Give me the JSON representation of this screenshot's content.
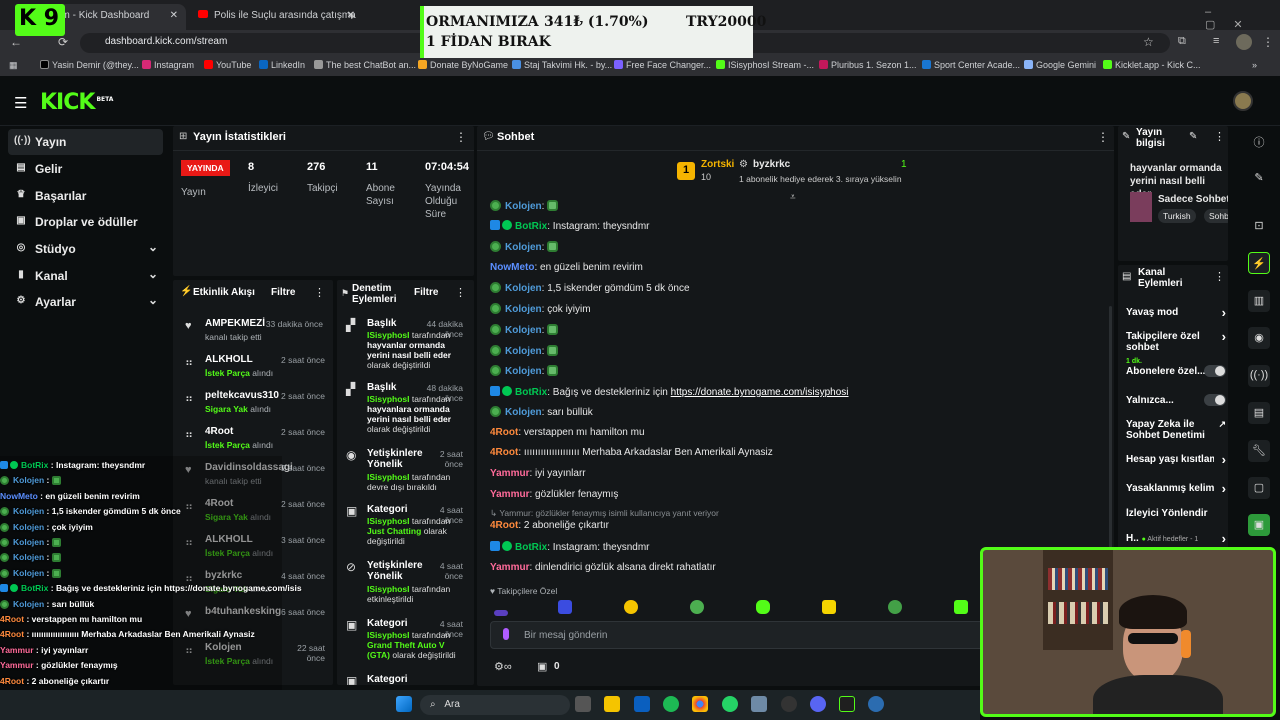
{
  "browser": {
    "tabs": [
      {
        "label": "am - Kick Dashboard"
      },
      {
        "label": "Polis ile Suçlu arasında çatışma"
      }
    ],
    "url": "dashboard.kick.com/stream",
    "bookmarks": [
      "Yasin Demir (@they...",
      "Instagram",
      "YouTube",
      "LinkedIn",
      "The best ChatBot an...",
      "Donate ByNoGame",
      "Staj Takvimi Hk. - by...",
      "Free Face Changer...",
      "ISisyphosI Stream -...",
      "Pluribus 1. Sezon 1...",
      "Sport Center Acade...",
      "Google Gemini",
      "Kicklet.app - Kick C..."
    ]
  },
  "overlay": {
    "channel_badge": "9",
    "banner_line1": "ORMANIMIZA",
    "banner_amount": "341₺ (1.70%)",
    "banner_goal": "TRY20000",
    "banner_line2": "1 FİDAN BIRAK"
  },
  "brand": {
    "logo": "KICK",
    "beta": "BETA"
  },
  "sidebar": {
    "items": [
      {
        "label": "Yayın",
        "icon": "broadcast-icon"
      },
      {
        "label": "Gelir",
        "icon": "wallet-icon"
      },
      {
        "label": "Başarılar",
        "icon": "trophy-icon"
      },
      {
        "label": "Droplar ve ödüller",
        "icon": "gift-icon"
      },
      {
        "label": "Stüdyo",
        "icon": "studio-icon"
      },
      {
        "label": "Kanal",
        "icon": "channel-icon"
      },
      {
        "label": "Ayarlar",
        "icon": "gear-icon"
      }
    ]
  },
  "stats": {
    "title": "Yayın İstatistikleri",
    "live": "YAYINDA",
    "live_label": "Yayın",
    "items": [
      {
        "value": "8",
        "label": "İzleyici"
      },
      {
        "value": "276",
        "label": "Takipçi"
      },
      {
        "value": "11",
        "label": "Abone Sayısı"
      },
      {
        "value": "07:04:54",
        "label": "Yayında Olduğu Süre"
      }
    ]
  },
  "activity": {
    "title": "Etkinlik Akışı",
    "filter": "Filtre",
    "events": [
      {
        "name": "AMPEKMEZİ",
        "time": "33 dakika önce",
        "sub": "kanalı takip etti",
        "green": ""
      },
      {
        "name": "ALKHOLL",
        "time": "2 saat önce",
        "sub": "alındı",
        "green": "İstek Parça"
      },
      {
        "name": "peltekcavus310",
        "time": "2 saat önce",
        "sub": "alındı",
        "green": "Sigara Yak"
      },
      {
        "name": "4Root",
        "time": "2 saat önce",
        "sub": "alındı",
        "green": "İstek Parça"
      },
      {
        "name": "Davidinsoldassagi",
        "time": "2 saat önce",
        "sub": "kanalı takip etti",
        "green": ""
      },
      {
        "name": "4Root",
        "time": "2 saat önce",
        "sub": "alındı",
        "green": "Sigara Yak"
      },
      {
        "name": "ALKHOLL",
        "time": "3 saat önce",
        "sub": "alındı",
        "green": "İstek Parça"
      },
      {
        "name": "byzkrkc",
        "time": "4 saat önce",
        "sub": "alındı",
        "green": "Sigara Yak"
      },
      {
        "name": "b4tuhankesking",
        "time": "6 saat önce",
        "sub": "",
        "green": ""
      },
      {
        "name": "Kolojen",
        "time": "22 saat önce",
        "sub": "alındı",
        "green": "İstek Parça"
      }
    ]
  },
  "moderation": {
    "title": "Denetim Eylemleri",
    "filter": "Filtre",
    "entries": [
      {
        "title": "Başlık",
        "time": "44 dakika önce",
        "user": "ISisyphosI",
        "body": "tarafından",
        "detail": "hayvanlar ormanda yerini nasıl belli eder",
        "tail": "olarak değiştirildi"
      },
      {
        "title": "Başlık",
        "time": "48 dakika önce",
        "user": "ISisyphosI",
        "body": "tarafından",
        "detail": "hayvanlara ormanda yerini nasıl belli eder",
        "tail": "olarak değiştirildi"
      },
      {
        "title": "Yetişkinlere Yönelik",
        "time": "2 saat önce",
        "user": "ISisyphosI",
        "body": "tarafından",
        "detail": "",
        "tail": "devre dışı bırakıldı"
      },
      {
        "title": "Kategori",
        "time": "4 saat önce",
        "user": "ISisyphosI",
        "body": "tarafından",
        "detail": "Just Chatting",
        "tail": "olarak değiştirildi"
      },
      {
        "title": "Yetişkinlere Yönelik",
        "time": "4 saat önce",
        "user": "ISisyphosI",
        "body": "tarafından",
        "detail": "",
        "tail": "etkinleştirildi"
      },
      {
        "title": "Kategori",
        "time": "4 saat önce",
        "user": "ISisyphosI",
        "body": "tarafından",
        "detail": "Grand Theft Auto V (GTA)",
        "tail": "olarak değiştirildi"
      },
      {
        "title": "Kategori",
        "time": "",
        "user": "",
        "body": "",
        "detail": "",
        "tail": ""
      }
    ]
  },
  "chat": {
    "title": "Sohbet",
    "pinned_user": "Zortski",
    "pinned_count": "10",
    "gifter": "byzkrkc",
    "gift_count": "1",
    "gift_text": "1 abonelik hediye ederek 3. sıraya yükselin",
    "messages": [
      {
        "user": "Kolojen",
        "text": "",
        "color": "#4f9bd9",
        "type": "frog"
      },
      {
        "user": "BotRix",
        "text": "Instagram: theysndmr",
        "color": "#00c853",
        "type": "bot"
      },
      {
        "user": "Kolojen",
        "text": "",
        "color": "#4f9bd9",
        "type": "frog"
      },
      {
        "user": "NowMeto",
        "text": "en güzeli benim revirim",
        "color": "#5b8fff",
        "type": "plain"
      },
      {
        "user": "Kolojen",
        "text": "1,5 iskender gömdüm 5 dk önce",
        "color": "#4f9bd9",
        "type": "frog"
      },
      {
        "user": "Kolojen",
        "text": "çok iyiyim",
        "color": "#4f9bd9",
        "type": "frog"
      },
      {
        "user": "Kolojen",
        "text": "",
        "color": "#4f9bd9",
        "type": "frog"
      },
      {
        "user": "Kolojen",
        "text": "",
        "color": "#4f9bd9",
        "type": "frog"
      },
      {
        "user": "Kolojen",
        "text": "",
        "color": "#4f9bd9",
        "type": "frog"
      },
      {
        "user": "BotRix",
        "text": "Bağış ve destekleriniz için https://donate.bynogame.com/isisyphosi",
        "color": "#00c853",
        "type": "bot"
      },
      {
        "user": "Kolojen",
        "text": "sarı büllük",
        "color": "#4f9bd9",
        "type": "frog"
      },
      {
        "user": "4Root",
        "text": "verstappen mı hamilton mu",
        "color": "#ff8a3d",
        "type": "plain"
      },
      {
        "user": "4Root",
        "text": "ıııııııııııııııııııı Merhaba Arkadaslar Ben Amerikali Aynasiz",
        "color": "#ff8a3d",
        "type": "plain"
      },
      {
        "user": "Yammur",
        "text": "iyi yayınlarr",
        "color": "#ff6b9a",
        "type": "plain"
      },
      {
        "user": "Yammur",
        "text": "gözlükler fenaymış",
        "color": "#ff6b9a",
        "type": "plain"
      },
      {
        "user": "4Root",
        "text": "2 aboneliğe çıkartır",
        "color": "#ff8a3d",
        "type": "reply",
        "reply": "Yammur: gözlükler fenaymış isimli kullanıcıya yanıt veriyor"
      },
      {
        "user": "BotRix",
        "text": "Instagram: theysndmr",
        "color": "#00c853",
        "type": "bot"
      },
      {
        "user": "Yammur",
        "text": "dinlendirici gözlük alsana direkt rahatlatır",
        "color": "#ff6b9a",
        "type": "plain"
      }
    ],
    "followers_only": "Takipçilere Özel",
    "placeholder": "Bir mesaj gönderin",
    "bottom_count": "0"
  },
  "stream_info": {
    "title": "Yayın bilgisi",
    "stream_title": "hayvanlar ormanda yerini nasıl belli eder",
    "category": "Sadece Sohbet",
    "tags": [
      "Turkish",
      "Sohb"
    ]
  },
  "channel_actions": {
    "title": "Kanal Eylemleri",
    "items": [
      {
        "label": "Yavaş mod",
        "type": "chevron",
        "extra": ""
      },
      {
        "label": "Takipçilere özel sohbet",
        "type": "chevron",
        "extra": "1 dk."
      },
      {
        "label": "Abonelere özel...",
        "type": "toggle",
        "extra": ""
      },
      {
        "label": "Yalnızca...",
        "type": "toggle",
        "extra": ""
      },
      {
        "label": "Yapay Zeka ile Sohbet Denetimi",
        "type": "ext",
        "extra": ""
      },
      {
        "label": "Hesap yaşı kısıtlam",
        "type": "chevron",
        "extra": ""
      },
      {
        "label": "Yasaklanmış kelime",
        "type": "chevron",
        "extra": ""
      },
      {
        "label": "İzleyici Yönlendir",
        "type": "none",
        "extra": ""
      },
      {
        "label": "H..",
        "type": "chevron",
        "extra": "Aktif hedefler - 1"
      }
    ]
  },
  "overlay_chat": [
    {
      "user": "BotRix",
      "text": "Instagram: theysndmr",
      "color": "#00c853"
    },
    {
      "user": "Kolojen",
      "text": "",
      "color": "#4f9bd9"
    },
    {
      "user": "NowMeto",
      "text": "en güzeli benim revirim",
      "color": "#5b8fff"
    },
    {
      "user": "Kolojen",
      "text": "1,5 iskender gömdüm 5 dk önce",
      "color": "#4f9bd9"
    },
    {
      "user": "Kolojen",
      "text": "çok iyiyim",
      "color": "#4f9bd9"
    },
    {
      "user": "Kolojen",
      "text": "",
      "color": "#4f9bd9"
    },
    {
      "user": "Kolojen",
      "text": "",
      "color": "#4f9bd9"
    },
    {
      "user": "Kolojen",
      "text": "",
      "color": "#4f9bd9"
    },
    {
      "user": "BotRix",
      "text": "Bağış ve destekleriniz için https://donate.bynogame.com/isis",
      "color": "#00c853"
    },
    {
      "user": "Kolojen",
      "text": "sarı büllük",
      "color": "#4f9bd9"
    },
    {
      "user": "4Root",
      "text": "verstappen mı hamilton mu",
      "color": "#ff8a3d"
    },
    {
      "user": "4Root",
      "text": "ıııııııııııııııııııı Merhaba Arkadaslar Ben Amerikali Aynasiz",
      "color": "#ff8a3d"
    },
    {
      "user": "Yammur",
      "text": "iyi yayınlarr",
      "color": "#ff6b9a"
    },
    {
      "user": "Yammur",
      "text": "gözlükler fenaymış",
      "color": "#ff6b9a"
    },
    {
      "user": "4Root",
      "text": "2 aboneliğe çıkartır",
      "color": "#ff8a3d"
    },
    {
      "user": "BotRix",
      "text": "Instagram: theysndmr",
      "color": "#00c853"
    },
    {
      "user": "Yammur",
      "text": "dinlendirici gözlük alsana direkt rahatlatır",
      "color": "#ff6b9a"
    }
  ],
  "taskbar": {
    "search": "Ara"
  },
  "colors": {
    "accent": "#53fc18",
    "live": "#e91916",
    "bg": "#0b0e0f",
    "panel": "#141719"
  }
}
